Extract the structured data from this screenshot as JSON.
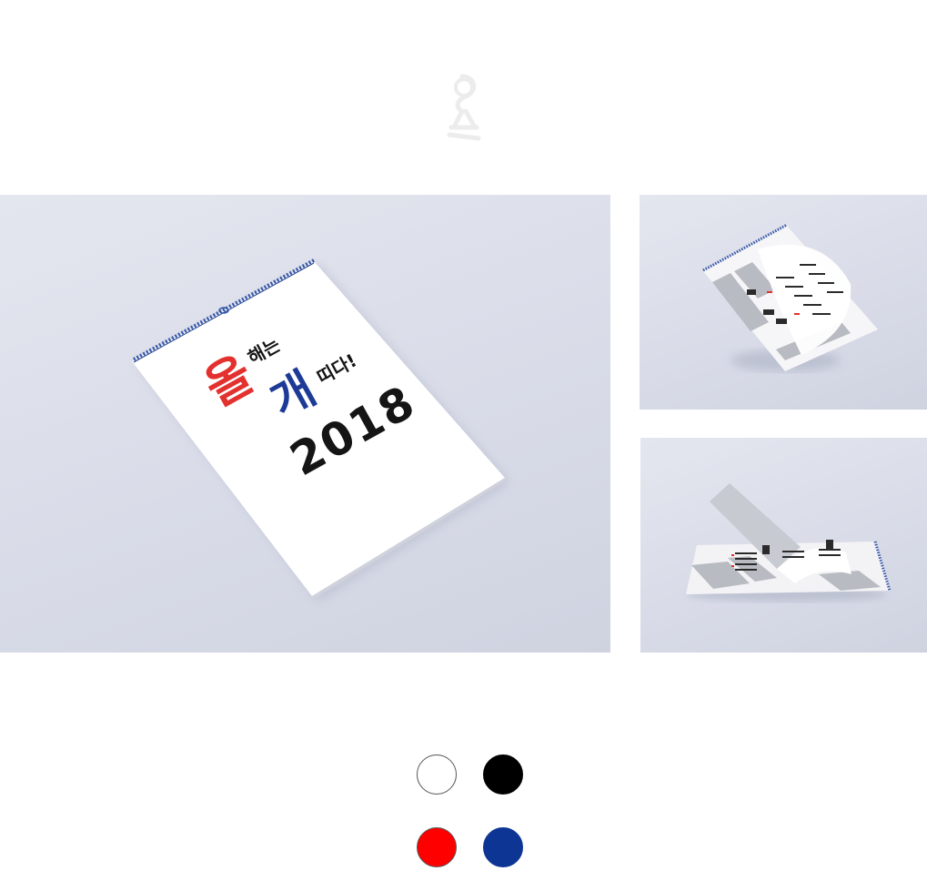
{
  "logo": {
    "icon": "brand-logo-icon",
    "color": "#eeeeee"
  },
  "main_mockup": {
    "cover": {
      "headline_big_red": "올",
      "headline_small_1": "해는",
      "headline_big_blue": "개",
      "headline_small_2": "띠다!",
      "year": "2018"
    },
    "colors": {
      "red": "#e3312f",
      "blue": "#1d3b96",
      "black": "#151515",
      "spiral": "#3557a8"
    }
  },
  "swatches": {
    "items": [
      {
        "id": "white",
        "color": "#ffffff",
        "border": "#555555"
      },
      {
        "id": "black",
        "color": "#000000",
        "border": "#000000"
      },
      {
        "id": "red",
        "color": "#ff0000",
        "border": "#555555"
      },
      {
        "id": "blue",
        "color": "#0d3593",
        "border": "#0d3593"
      }
    ]
  }
}
